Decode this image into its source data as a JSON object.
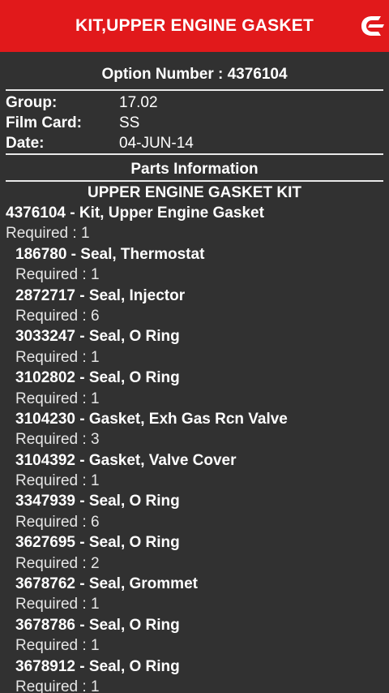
{
  "app_bar": {
    "title": "KIT,UPPER ENGINE GASKET",
    "logo_icon": "cummins-logo-icon",
    "background": "#e1191b"
  },
  "option": {
    "title": "Option Number : 4376104"
  },
  "info": {
    "group_label": "Group:",
    "group_value": "17.02",
    "film_card_label": "Film Card:",
    "film_card_value": "SS",
    "date_label": "Date:",
    "date_value": "04-JUN-14"
  },
  "parts_section": {
    "title": "Parts Information",
    "kit_title": "UPPER ENGINE GASKET KIT"
  },
  "parts": [
    {
      "name": "4376104 - Kit, Upper Engine Gasket",
      "required": "Required : 1",
      "top_level": true
    },
    {
      "name": "186780 - Seal, Thermostat",
      "required": "Required : 1"
    },
    {
      "name": "2872717 - Seal, Injector",
      "required": "Required : 6"
    },
    {
      "name": "3033247 - Seal, O Ring",
      "required": "Required : 1"
    },
    {
      "name": "3102802 - Seal, O Ring",
      "required": "Required : 1"
    },
    {
      "name": "3104230 - Gasket, Exh Gas Rcn Valve",
      "required": "Required : 3"
    },
    {
      "name": "3104392 - Gasket, Valve Cover",
      "required": "Required : 1"
    },
    {
      "name": "3347939 - Seal, O Ring",
      "required": "Required : 6"
    },
    {
      "name": "3627695 - Seal, O Ring",
      "required": "Required : 2"
    },
    {
      "name": "3678762 - Seal, Grommet",
      "required": "Required : 1"
    },
    {
      "name": "3678786 - Seal, O Ring",
      "required": "Required : 1"
    },
    {
      "name": "3678912 - Seal, O Ring",
      "required": "Required : 1"
    }
  ]
}
